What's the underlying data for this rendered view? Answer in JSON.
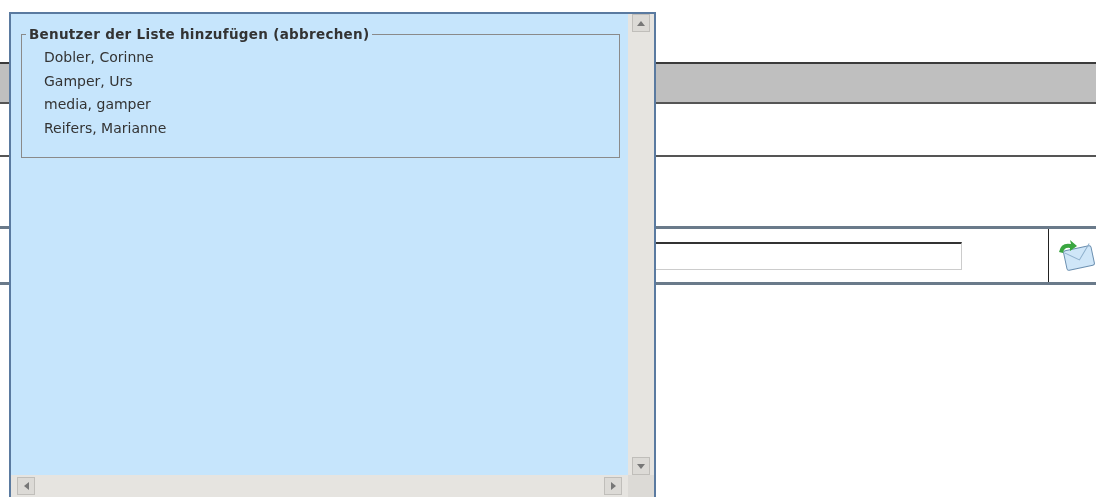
{
  "popup": {
    "legend": "Benutzer der Liste hinzufügen (abbrechen)",
    "users": [
      "Dobler, Corinne",
      "Gamper, Urs",
      "media, gamper",
      "Reifers, Marianne"
    ]
  }
}
